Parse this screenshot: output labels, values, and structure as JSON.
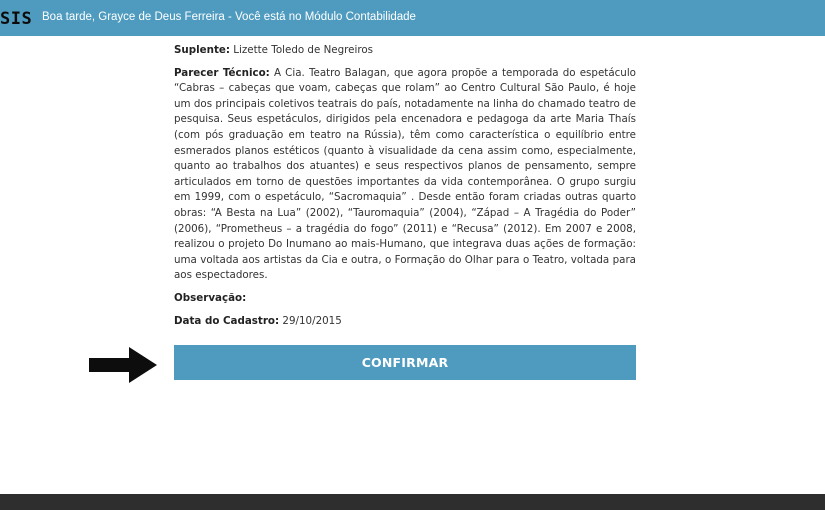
{
  "header": {
    "logo": "SIS",
    "greeting": "Boa tarde, Grayce de Deus Ferreira - Você está no Módulo Contabilidade"
  },
  "details": {
    "suplente_label": "Suplente:",
    "suplente_value": "Lizette Toledo de Negreiros",
    "parecer_label": "Parecer Técnico:",
    "parecer_value": "A Cia. Teatro Balagan, que agora propõe a temporada do espetáculo “Cabras – cabeças que voam, cabeças que rolam” ao Centro Cultural São Paulo, é hoje um dos principais coletivos teatrais do país, notadamente na linha do chamado teatro de pesquisa. Seus espetáculos, dirigidos pela encenadora e pedagoga da arte Maria Thaís (com pós graduação em teatro na Rússia), têm como característica o equilíbrio entre esmerados planos estéticos (quanto à visualidade da cena assim como, especialmente, quanto ao trabalhos dos atuantes) e seus respectivos planos de pensamento, sempre articulados em torno de questões importantes da vida contemporânea. O grupo surgiu em 1999, com o espetáculo, “Sacromaquia” . Desde então foram criadas outras quarto obras: “A Besta na Lua” (2002), “Tauromaquia” (2004), “Západ – A Tragédia do Poder” (2006), “Prometheus – a tragédia do fogo” (2011) e “Recusa” (2012). Em 2007 e 2008, realizou o projeto Do Inumano ao mais-Humano, que integrava duas ações de formação: uma voltada aos artistas da Cia e outra, o Formação do Olhar para o Teatro, voltada para aos espectadores.",
    "observacao_label": "Observação:",
    "observacao_value": "",
    "data_label": "Data do Cadastro:",
    "data_value": "29/10/2015"
  },
  "actions": {
    "confirm_label": "CONFIRMAR",
    "arrow_icon": "arrow-right-icon"
  },
  "colors": {
    "accent": "#4f9bbf",
    "footer": "#2e2e2e"
  }
}
